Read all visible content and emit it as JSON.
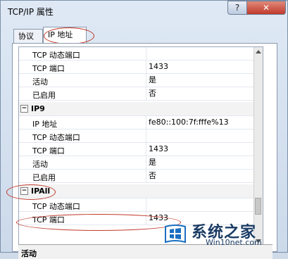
{
  "window": {
    "title": "TCP/IP 属性",
    "help_label": "?",
    "close_label": "✕"
  },
  "tabs": [
    {
      "label": "协议"
    },
    {
      "label": "IP 地址"
    }
  ],
  "rows": [
    {
      "name": "TCP 动态端口",
      "value": ""
    },
    {
      "name": "TCP 端口",
      "value": "1433"
    },
    {
      "name": "活动",
      "value": "是"
    },
    {
      "name": "已启用",
      "value": "否"
    }
  ],
  "sections": [
    {
      "label": "IP9",
      "toggle": "−",
      "rows": [
        {
          "name": "IP 地址",
          "value": "fe80::100:7f:fffe%13"
        },
        {
          "name": "TCP 动态端口",
          "value": ""
        },
        {
          "name": "TCP 端口",
          "value": "1433"
        },
        {
          "name": "活动",
          "value": "是"
        },
        {
          "name": "已启用",
          "value": "否"
        }
      ]
    },
    {
      "label": "IPAll",
      "toggle": "−",
      "rows": [
        {
          "name": "TCP 动态端口",
          "value": ""
        },
        {
          "name": "TCP 端口",
          "value": "1433"
        }
      ]
    }
  ],
  "description": {
    "title": "活动"
  },
  "watermark": {
    "brand": "系统之家",
    "site": "Win10net.com",
    "logo_icon": "windows-logo-icon"
  },
  "colors": {
    "annotation": "#c0392b",
    "brand_text": "#1a3b63"
  }
}
